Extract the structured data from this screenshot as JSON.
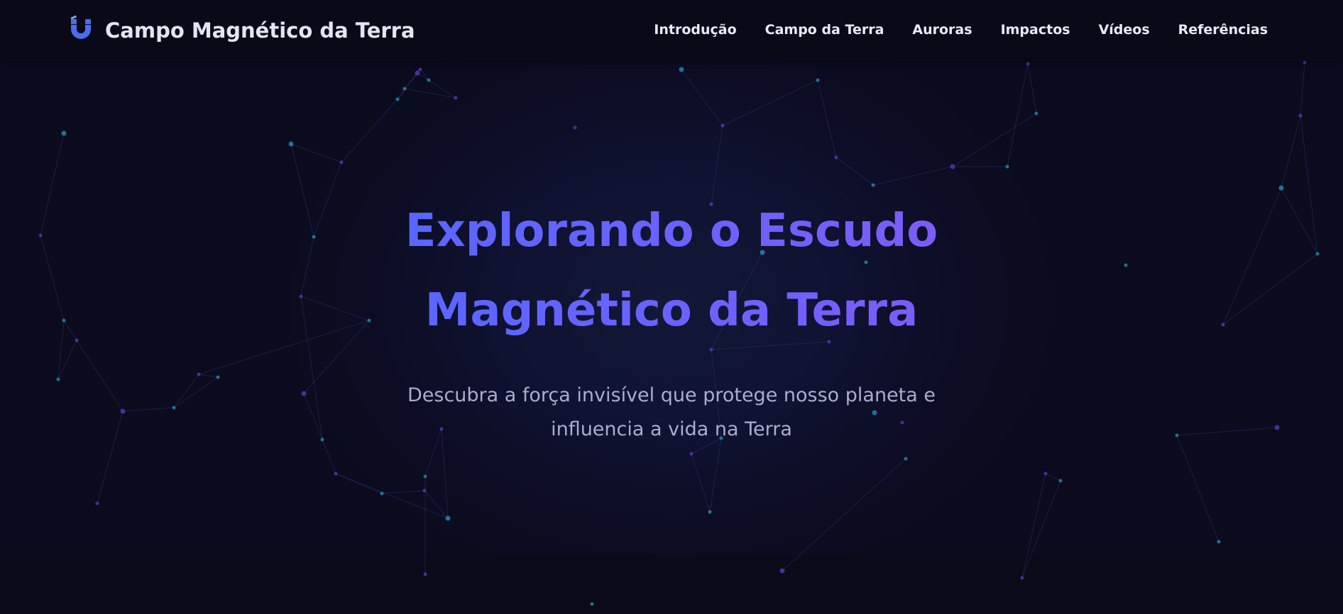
{
  "brand": {
    "title": "Campo Magnético da Terra",
    "icon": "magnet-icon",
    "icon_color": "#4a6cf0"
  },
  "nav": {
    "items": [
      {
        "label": "Introdução"
      },
      {
        "label": "Campo da Terra"
      },
      {
        "label": "Auroras"
      },
      {
        "label": "Impactos"
      },
      {
        "label": "Vídeos"
      },
      {
        "label": "Referências"
      }
    ]
  },
  "hero": {
    "title": "Explorando o Escudo Magnético da Terra",
    "subtitle": "Descubra a força invisível que protege nosso planeta e influencia a vida na Terra"
  },
  "colors": {
    "background": "#0b0b1c",
    "accent_blue": "#5866ff",
    "accent_purple": "#7d5cf5",
    "particle_cyan": "#1f9fc4",
    "particle_violet": "#5b3fd0"
  }
}
